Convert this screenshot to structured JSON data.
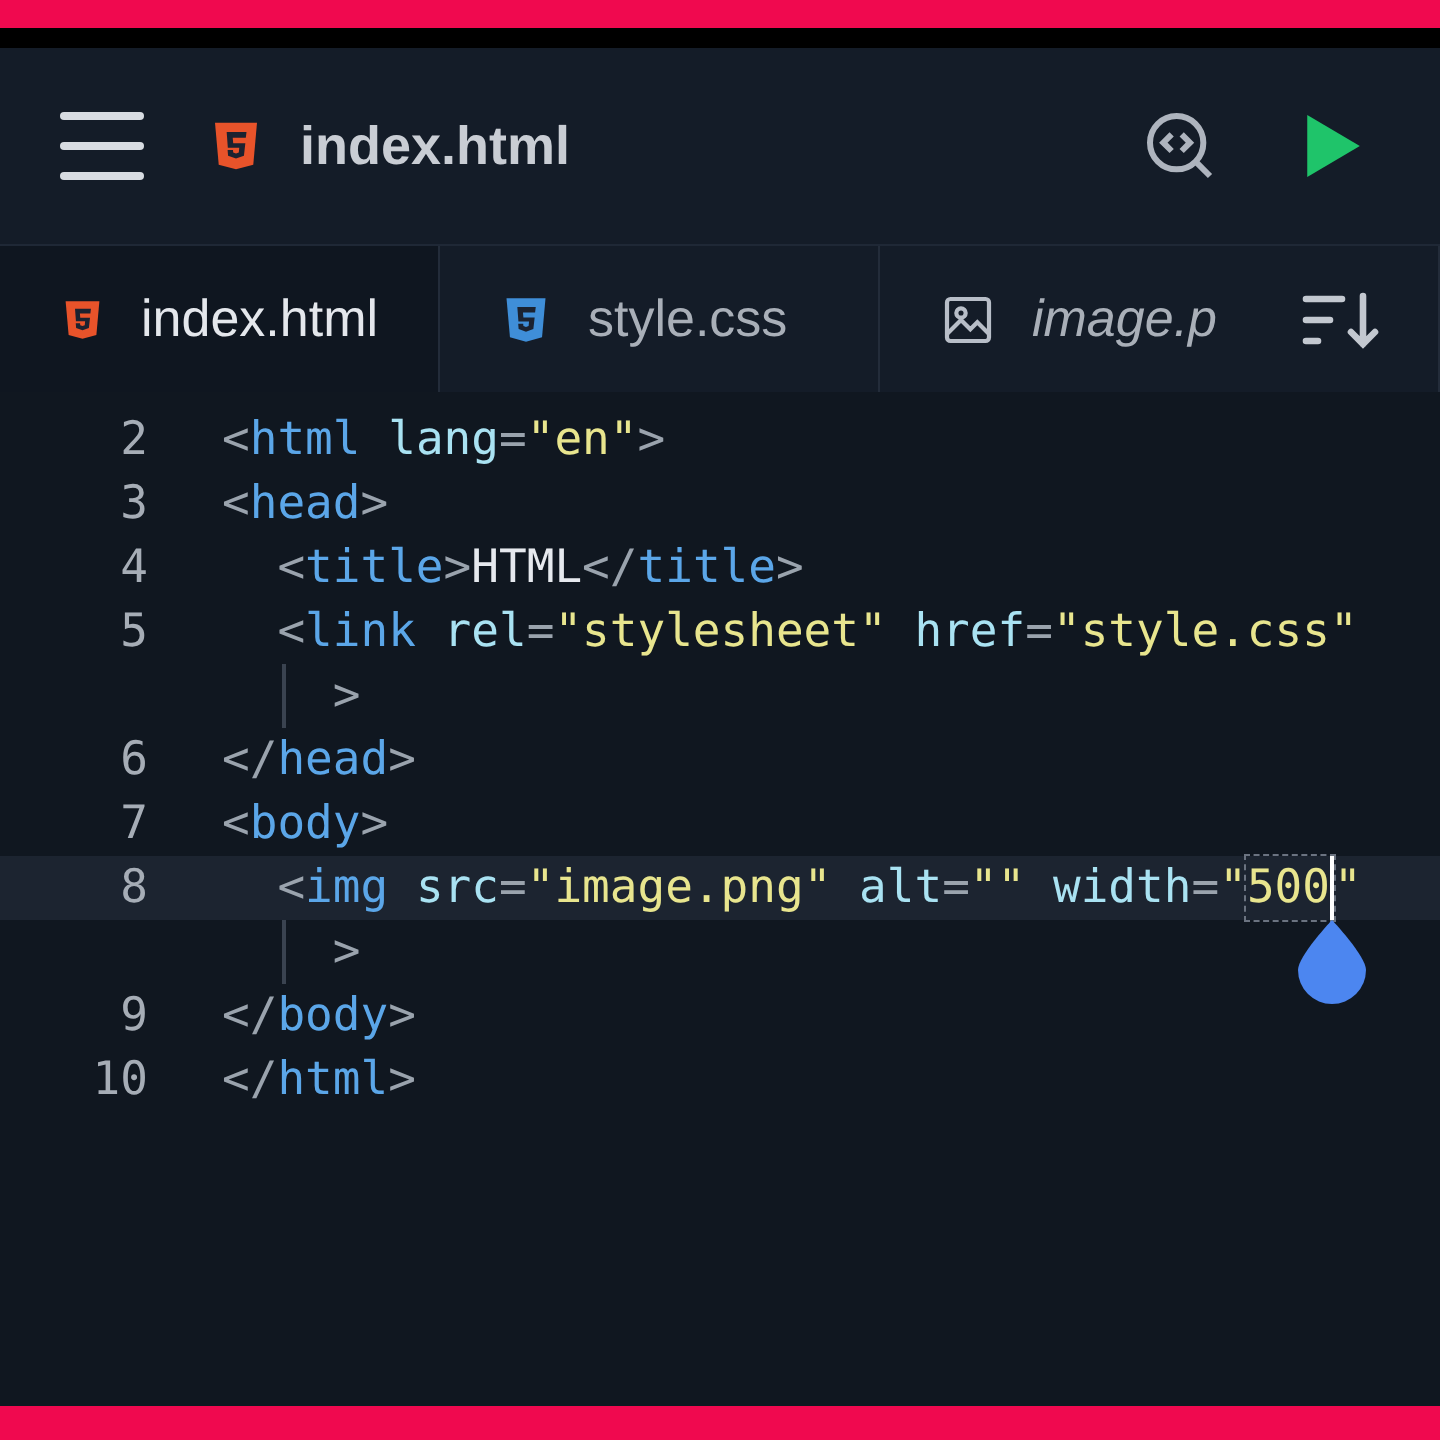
{
  "header": {
    "title": "index.html"
  },
  "tabs": [
    {
      "label": "index.html",
      "kind": "html",
      "selected": true
    },
    {
      "label": "style.css",
      "kind": "css",
      "selected": false
    },
    {
      "label": "image.p",
      "kind": "image",
      "selected": false
    }
  ],
  "editor": {
    "lines": [
      {
        "number": "2",
        "current": false,
        "tokens": [
          {
            "kind": "punct",
            "text": "<"
          },
          {
            "kind": "tag",
            "text": "html"
          },
          {
            "kind": "attr",
            "text": " lang"
          },
          {
            "kind": "punct",
            "text": "="
          },
          {
            "kind": "string",
            "text": "\"en\""
          },
          {
            "kind": "punct",
            "text": ">"
          }
        ]
      },
      {
        "number": "3",
        "current": false,
        "tokens": [
          {
            "kind": "punct",
            "text": "<"
          },
          {
            "kind": "tag",
            "text": "head"
          },
          {
            "kind": "punct",
            "text": ">"
          }
        ]
      },
      {
        "number": "4",
        "current": false,
        "tokens": [
          {
            "kind": "punct",
            "text": "  <"
          },
          {
            "kind": "tag",
            "text": "title"
          },
          {
            "kind": "punct",
            "text": ">"
          },
          {
            "kind": "text",
            "text": "HTML"
          },
          {
            "kind": "punct",
            "text": "</"
          },
          {
            "kind": "tag",
            "text": "title"
          },
          {
            "kind": "punct",
            "text": ">"
          }
        ]
      },
      {
        "number": "5",
        "current": false,
        "tokens": [
          {
            "kind": "punct",
            "text": "  <"
          },
          {
            "kind": "tag",
            "text": "link"
          },
          {
            "kind": "attr",
            "text": " rel"
          },
          {
            "kind": "punct",
            "text": "="
          },
          {
            "kind": "string",
            "text": "\"stylesheet\""
          },
          {
            "kind": "attr",
            "text": " href"
          },
          {
            "kind": "punct",
            "text": "="
          },
          {
            "kind": "string",
            "text": "\"style.css\""
          }
        ]
      },
      {
        "wrap": true,
        "current": false,
        "tokens": [
          {
            "kind": "punct",
            "text": "    >"
          }
        ]
      },
      {
        "number": "6",
        "current": false,
        "tokens": [
          {
            "kind": "punct",
            "text": "</"
          },
          {
            "kind": "tag",
            "text": "head"
          },
          {
            "kind": "punct",
            "text": ">"
          }
        ]
      },
      {
        "number": "7",
        "current": false,
        "tokens": [
          {
            "kind": "punct",
            "text": "<"
          },
          {
            "kind": "tag",
            "text": "body"
          },
          {
            "kind": "punct",
            "text": ">"
          }
        ]
      },
      {
        "number": "8",
        "current": true,
        "tokens": [
          {
            "kind": "punct",
            "text": "  <"
          },
          {
            "kind": "tag",
            "text": "img"
          },
          {
            "kind": "attr",
            "text": " src"
          },
          {
            "kind": "punct",
            "text": "="
          },
          {
            "kind": "string",
            "text": "\"image.png\""
          },
          {
            "kind": "attr",
            "text": " alt"
          },
          {
            "kind": "punct",
            "text": "="
          },
          {
            "kind": "string",
            "text": "\"\""
          },
          {
            "kind": "attr",
            "text": " width"
          },
          {
            "kind": "punct",
            "text": "="
          },
          {
            "kind": "string",
            "text": "\""
          },
          {
            "kind": "string",
            "text": "500",
            "selected": true
          },
          {
            "kind": "string",
            "text": "\""
          }
        ]
      },
      {
        "wrap": true,
        "current": false,
        "tokens": [
          {
            "kind": "punct",
            "text": "    >"
          }
        ]
      },
      {
        "number": "9",
        "current": false,
        "tokens": [
          {
            "kind": "punct",
            "text": "</"
          },
          {
            "kind": "tag",
            "text": "body"
          },
          {
            "kind": "punct",
            "text": ">"
          }
        ]
      },
      {
        "number": "10",
        "current": false,
        "tokens": [
          {
            "kind": "punct",
            "text": "</"
          },
          {
            "kind": "tag",
            "text": "html"
          },
          {
            "kind": "punct",
            "text": ">"
          }
        ]
      }
    ]
  }
}
